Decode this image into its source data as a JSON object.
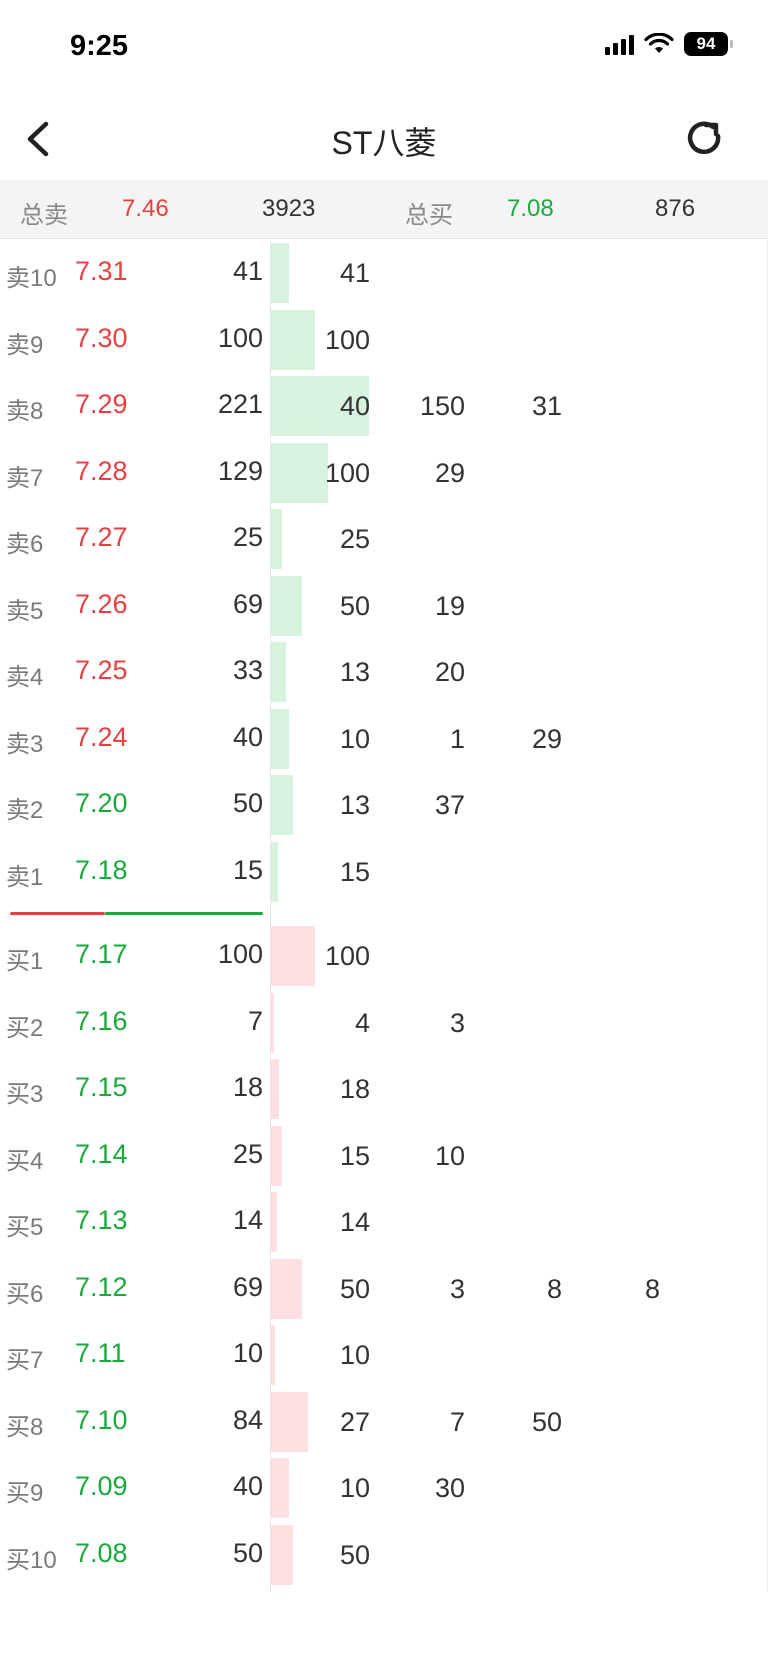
{
  "status": {
    "time": "9:25",
    "battery": "94"
  },
  "nav": {
    "title": "ST八菱"
  },
  "summary": {
    "sell_label": "总卖",
    "sell_price": "7.46",
    "sell_volume": "3923",
    "buy_label": "总买",
    "buy_price": "7.08",
    "buy_volume": "876"
  },
  "asks": [
    {
      "label": "卖10",
      "price": "7.31",
      "volume": "41",
      "orders": [
        "41"
      ]
    },
    {
      "label": "卖9",
      "price": "7.30",
      "volume": "100",
      "orders": [
        "100"
      ]
    },
    {
      "label": "卖8",
      "price": "7.29",
      "volume": "221",
      "orders": [
        "40",
        "150",
        "31"
      ]
    },
    {
      "label": "卖7",
      "price": "7.28",
      "volume": "129",
      "orders": [
        "100",
        "29"
      ]
    },
    {
      "label": "卖6",
      "price": "7.27",
      "volume": "25",
      "orders": [
        "25"
      ]
    },
    {
      "label": "卖5",
      "price": "7.26",
      "volume": "69",
      "orders": [
        "50",
        "19"
      ]
    },
    {
      "label": "卖4",
      "price": "7.25",
      "volume": "33",
      "orders": [
        "13",
        "20"
      ]
    },
    {
      "label": "卖3",
      "price": "7.24",
      "volume": "40",
      "orders": [
        "10",
        "1",
        "29"
      ]
    },
    {
      "label": "卖2",
      "price": "7.20",
      "volume": "50",
      "orders": [
        "13",
        "37"
      ]
    },
    {
      "label": "卖1",
      "price": "7.18",
      "volume": "15",
      "orders": [
        "15"
      ]
    }
  ],
  "bids": [
    {
      "label": "买1",
      "price": "7.17",
      "volume": "100",
      "orders": [
        "100"
      ]
    },
    {
      "label": "买2",
      "price": "7.16",
      "volume": "7",
      "orders": [
        "4",
        "3"
      ]
    },
    {
      "label": "买3",
      "price": "7.15",
      "volume": "18",
      "orders": [
        "18"
      ]
    },
    {
      "label": "买4",
      "price": "7.14",
      "volume": "25",
      "orders": [
        "15",
        "10"
      ]
    },
    {
      "label": "买5",
      "price": "7.13",
      "volume": "14",
      "orders": [
        "14"
      ]
    },
    {
      "label": "买6",
      "price": "7.12",
      "volume": "69",
      "orders": [
        "50",
        "3",
        "8",
        "8"
      ]
    },
    {
      "label": "买7",
      "price": "7.11",
      "volume": "10",
      "orders": [
        "10"
      ]
    },
    {
      "label": "买8",
      "price": "7.10",
      "volume": "84",
      "orders": [
        "27",
        "7",
        "50"
      ]
    },
    {
      "label": "买9",
      "price": "7.09",
      "volume": "40",
      "orders": [
        "10",
        "30"
      ]
    },
    {
      "label": "买10",
      "price": "7.08",
      "volume": "50",
      "orders": [
        "50"
      ]
    }
  ],
  "colors": {
    "up": "#e84040",
    "down": "#1aaa3c",
    "ask_bar": "#d8f2e0",
    "bid_bar": "#fde0e2"
  },
  "icons": {
    "back": "chevron-left-icon",
    "refresh": "refresh-icon"
  }
}
